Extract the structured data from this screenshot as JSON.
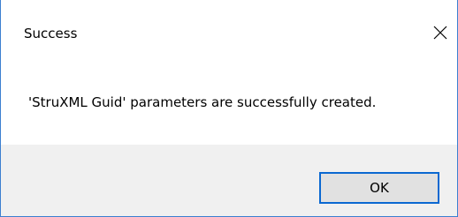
{
  "window": {
    "title": "Success",
    "close_icon": "close-icon",
    "accent_color": "#3c7fd0"
  },
  "body": {
    "message": "'StruXML Guid' parameters are successfully created."
  },
  "footer": {
    "ok_label": "OK",
    "ok_border_color": "#0a68d1"
  }
}
